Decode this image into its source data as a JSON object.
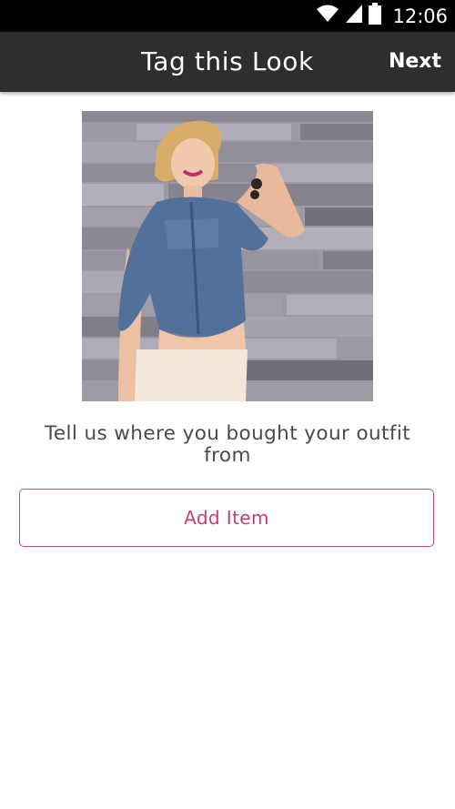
{
  "status_bar": {
    "time": "12:06",
    "icons": [
      "wifi-icon",
      "signal-icon",
      "battery-icon"
    ]
  },
  "app_bar": {
    "title": "Tag this Look",
    "next_label": "Next"
  },
  "photo": {
    "subject": "look-photo"
  },
  "prompt_text": "Tell us where you bought your outfit from",
  "add_item_label": "Add Item",
  "colors": {
    "status_bar_bg": "#000000",
    "app_bar_bg": "#2e2e2c",
    "accent": "#c43f6f",
    "prompt_text": "#4a4a4a"
  }
}
